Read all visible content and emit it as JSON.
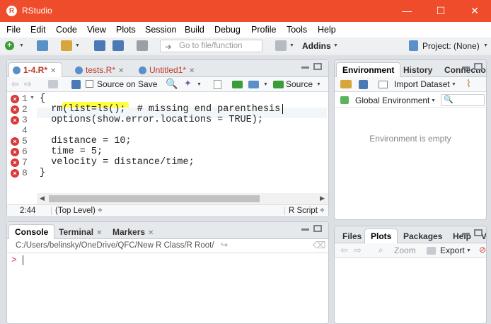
{
  "window": {
    "title": "RStudio",
    "minimize": "—",
    "maximize": "☐",
    "close": "✕"
  },
  "menu": [
    "File",
    "Edit",
    "Code",
    "View",
    "Plots",
    "Session",
    "Build",
    "Debug",
    "Profile",
    "Tools",
    "Help"
  ],
  "toolbar": {
    "goto_placeholder": "Go to file/function",
    "addins": "Addins",
    "project": "Project: (None)"
  },
  "editor": {
    "tabs": [
      {
        "label": "1-4.R*"
      },
      {
        "label": "tests.R*"
      },
      {
        "label": "Untitled1*"
      }
    ],
    "source_on_save": "Source on Save",
    "source_button": "Source",
    "lines": [
      {
        "num": "1",
        "text": "{"
      },
      {
        "num": "2",
        "text": "  rm(list=ls();  # missing end parenthesis"
      },
      {
        "num": "3",
        "text": "  options(show.error.locations = TRUE);"
      },
      {
        "num": "4",
        "text": ""
      },
      {
        "num": "5",
        "text": "  distance = 10;"
      },
      {
        "num": "6",
        "text": "  time = 5;"
      },
      {
        "num": "7",
        "text": "  velocity = distance/time;"
      },
      {
        "num": "8",
        "text": "}"
      }
    ],
    "status_pos": "2:44",
    "status_scope": "(Top Level) ÷",
    "status_type": "R Script ÷"
  },
  "console": {
    "tabs": [
      {
        "label": "Console"
      },
      {
        "label": "Terminal"
      },
      {
        "label": "Markers"
      }
    ],
    "path": "C:/Users/belinsky/OneDrive/QFC/New R Class/R Root/",
    "prompt": ">"
  },
  "env": {
    "tabs": [
      {
        "label": "Environment"
      },
      {
        "label": "History"
      },
      {
        "label": "Connections"
      }
    ],
    "import_dataset": "Import Dataset",
    "global_env": "Global Environment",
    "empty_msg": "Environment is empty"
  },
  "files": {
    "tabs": [
      {
        "label": "Files"
      },
      {
        "label": "Plots"
      },
      {
        "label": "Packages"
      },
      {
        "label": "Help"
      },
      {
        "label": "V"
      }
    ],
    "zoom": "Zoom",
    "export": "Export"
  },
  "colors": {
    "titlebar": "#ef4c2b",
    "highlight": "#ffff3a",
    "error": "#d63a3a"
  }
}
